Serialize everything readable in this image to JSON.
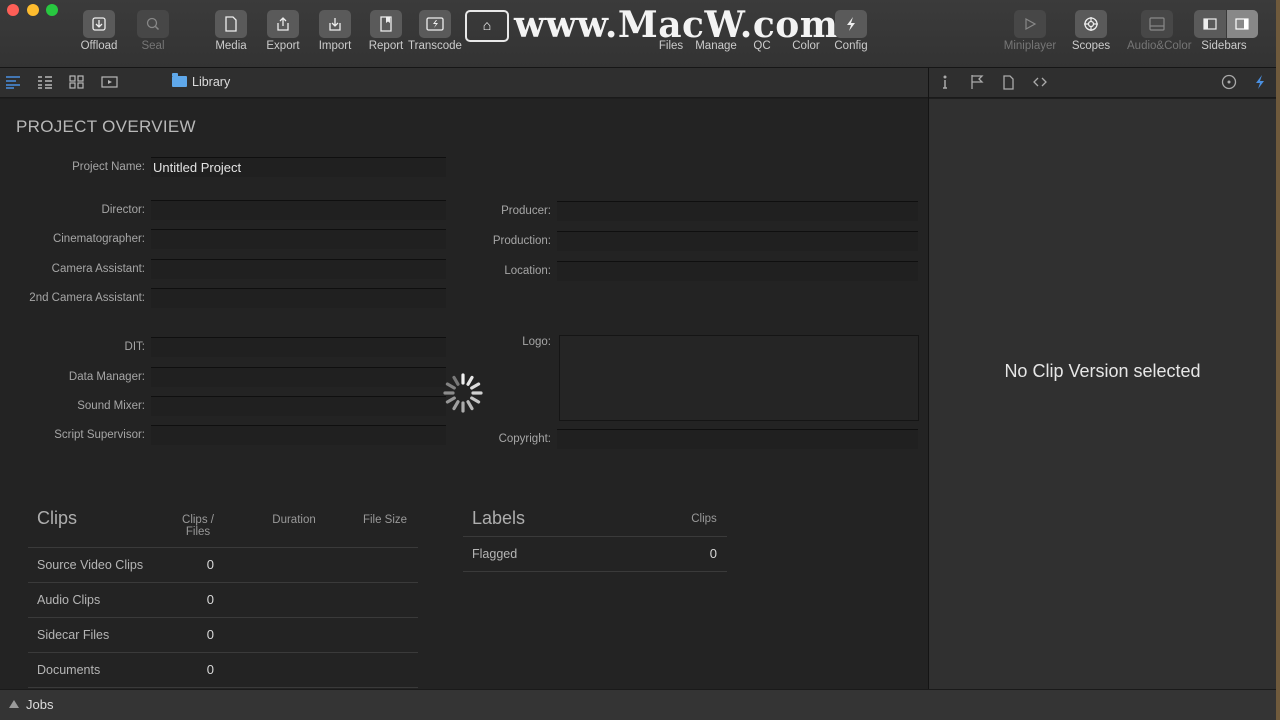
{
  "toolbar": {
    "buttons": [
      {
        "label": "Offload",
        "icon": "offload-icon"
      },
      {
        "label": "Seal",
        "icon": "seal-icon",
        "disabled": true
      },
      {
        "label": "Media",
        "icon": "media-icon"
      },
      {
        "label": "Export",
        "icon": "export-icon"
      },
      {
        "label": "Import",
        "icon": "import-icon"
      },
      {
        "label": "Report",
        "icon": "report-icon"
      },
      {
        "label": "Transcode",
        "icon": "transcode-icon"
      },
      {
        "label": "Files",
        "icon": "files-icon"
      },
      {
        "label": "Manage",
        "icon": "manage-icon"
      },
      {
        "label": "QC",
        "icon": "qc-icon"
      },
      {
        "label": "Color",
        "icon": "color-icon"
      },
      {
        "label": "Config",
        "icon": "config-icon"
      },
      {
        "label": "Miniplayer",
        "icon": "play-icon",
        "disabled": true
      },
      {
        "label": "Scopes",
        "icon": "scopes-icon"
      },
      {
        "label": "Audio&Color",
        "icon": "audio-color-icon",
        "disabled": true
      },
      {
        "label": "Sidebars",
        "icon": "sidebars-icon"
      }
    ],
    "watermark": "www.MacW.com"
  },
  "subbar": {
    "breadcrumb": "Library"
  },
  "overview": {
    "title": "PROJECT OVERVIEW",
    "project_name_label": "Project Name:",
    "project_name_value": "Untitled Project",
    "left_fields": [
      "Director:",
      "Cinematographer:",
      "Camera Assistant:",
      "2nd Camera Assistant:",
      "DIT:",
      "Data Manager:",
      "Sound Mixer:",
      "Script Supervisor:"
    ],
    "right_fields": [
      "Producer:",
      "Production:",
      "Location:",
      "Logo:",
      "Copyright:"
    ]
  },
  "clips": {
    "title": "Clips",
    "col_clips_files": "Clips / Files",
    "col_duration": "Duration",
    "col_file_size": "File Size",
    "rows": [
      {
        "name": "Source Video Clips",
        "count": "0"
      },
      {
        "name": "Audio Clips",
        "count": "0"
      },
      {
        "name": "Sidecar Files",
        "count": "0"
      },
      {
        "name": "Documents",
        "count": "0"
      }
    ]
  },
  "labels": {
    "title": "Labels",
    "col_clips": "Clips",
    "rows": [
      {
        "name": "Flagged",
        "count": "0"
      }
    ]
  },
  "right_panel": {
    "message": "No Clip Version selected"
  },
  "bottom": {
    "jobs_label": "Jobs"
  },
  "colors": {
    "accent": "#4a8fe0",
    "background": "#232323",
    "panel": "#303030"
  }
}
